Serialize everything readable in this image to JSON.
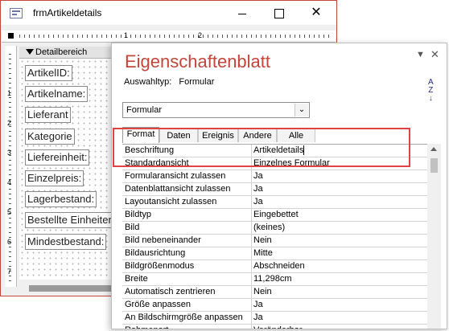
{
  "form_window": {
    "title": "frmArtikeldetails",
    "minimize_label": "",
    "maximize_label": "",
    "close_label": "✕",
    "ruler_h_numbers": [
      "1",
      "2"
    ],
    "ruler_v_numbers": [
      "1",
      "2",
      "3",
      "4",
      "5",
      "6",
      "7"
    ],
    "section_label": "Detailbereich",
    "fields": [
      "ArtikelID:",
      "Artikelname:",
      "Lieferant",
      "Kategorie",
      "Liefereinheit:",
      "Einzelpreis:",
      "Lagerbestand:",
      "Bestellte Einheiten",
      "Mindestbestand:"
    ]
  },
  "property_sheet": {
    "title": "Eigenschaftenblatt",
    "selection_type_label": "Auswahltyp:",
    "selection_type_value": "Formular",
    "dropdown_icon": "chevron-down-icon",
    "close_icon": "close-icon",
    "sort_icon": "sort-az-icon",
    "combo_value": "Formular",
    "tabs": [
      "Format",
      "Daten",
      "Ereignis",
      "Andere",
      "Alle"
    ],
    "active_tab": "Format",
    "properties": [
      {
        "name": "Beschriftung",
        "value": "Artikeldetails"
      },
      {
        "name": "Standardansicht",
        "value": "Einzelnes Formular"
      },
      {
        "name": "Formularansicht zulassen",
        "value": "Ja"
      },
      {
        "name": "Datenblattansicht zulassen",
        "value": "Ja"
      },
      {
        "name": "Layoutansicht zulassen",
        "value": "Ja"
      },
      {
        "name": "Bildtyp",
        "value": "Eingebettet"
      },
      {
        "name": "Bild",
        "value": "(keines)"
      },
      {
        "name": "Bild nebeneinander",
        "value": "Nein"
      },
      {
        "name": "Bildausrichtung",
        "value": "Mitte"
      },
      {
        "name": "Bildgrößenmodus",
        "value": "Abschneiden"
      },
      {
        "name": "Breite",
        "value": "11,298cm"
      },
      {
        "name": "Automatisch zentrieren",
        "value": "Nein"
      },
      {
        "name": "Größe anpassen",
        "value": "Ja"
      },
      {
        "name": "An Bildschirmgröße anpassen",
        "value": "Ja"
      },
      {
        "name": "Rahmenart",
        "value": "Veränderbar"
      }
    ]
  },
  "colors": {
    "accent": "#c4453b",
    "highlight": "#e04343"
  }
}
